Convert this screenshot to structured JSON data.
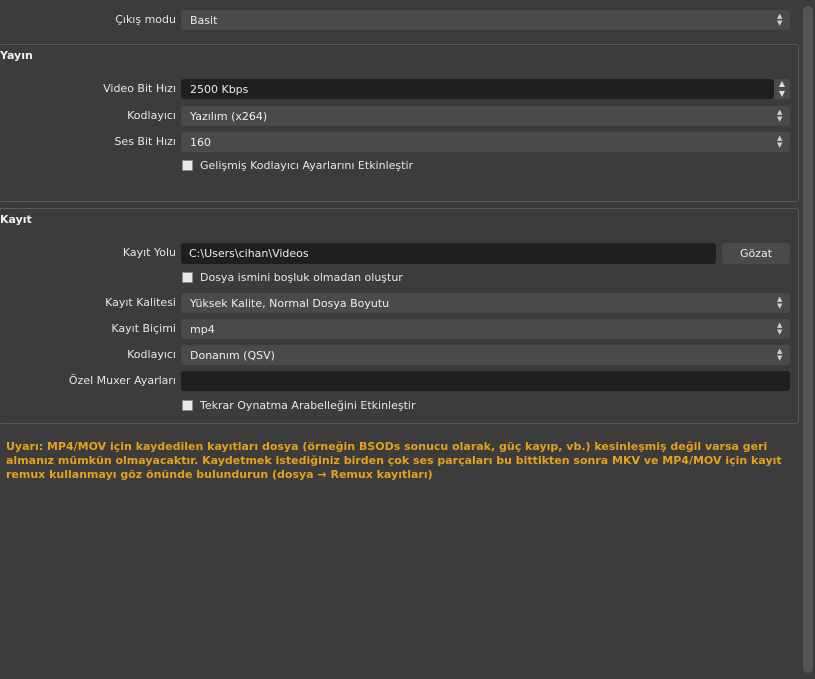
{
  "output_mode": {
    "label": "Çıkış modu",
    "value": "Basit"
  },
  "streaming": {
    "title": "Yayın",
    "video_bitrate": {
      "label": "Video Bit Hızı",
      "value": "2500 Kbps"
    },
    "encoder": {
      "label": "Kodlayıcı",
      "value": "Yazılım (x264)"
    },
    "audio_bitrate": {
      "label": "Ses Bit Hızı",
      "value": "160"
    },
    "advanced_encoder_checkbox": {
      "label": "Gelişmiş Kodlayıcı Ayarlarını Etkinleştir",
      "checked": false
    }
  },
  "recording": {
    "title": "Kayıt",
    "path": {
      "label": "Kayıt Yolu",
      "value": "C:\\Users\\cihan\\Videos",
      "browse_label": "Gözat"
    },
    "no_space_checkbox": {
      "label": "Dosya ismini boşluk olmadan oluştur",
      "checked": false
    },
    "quality": {
      "label": "Kayıt Kalitesi",
      "value": "Yüksek Kalite, Normal Dosya Boyutu"
    },
    "format": {
      "label": "Kayıt Biçimi",
      "value": "mp4"
    },
    "encoder": {
      "label": "Kodlayıcı",
      "value": "Donanım (QSV)"
    },
    "muxer": {
      "label": "Özel Muxer Ayarları",
      "value": ""
    },
    "replay_buffer_checkbox": {
      "label": "Tekrar Oynatma Arabelleğini Etkinleştir",
      "checked": false
    }
  },
  "warning": "Uyarı: MP4/MOV için kaydedilen kayıtları dosya (örneğin BSODs sonucu olarak, güç kayıp, vb.) kesinleşmiş değil varsa geri almanız mümkün olmayacaktır. Kaydetmek istediğiniz birden çok ses parçaları bu bittikten sonra MKV ve MP4/MOV için kayıt remux kullanmayı göz önünde bulundurun (dosya → Remux kayıtları)",
  "colors": {
    "background": "#3c3c3c",
    "input_dark": "#1f1f1f",
    "combo": "#4a4a4a",
    "warning": "#e3a21a"
  }
}
